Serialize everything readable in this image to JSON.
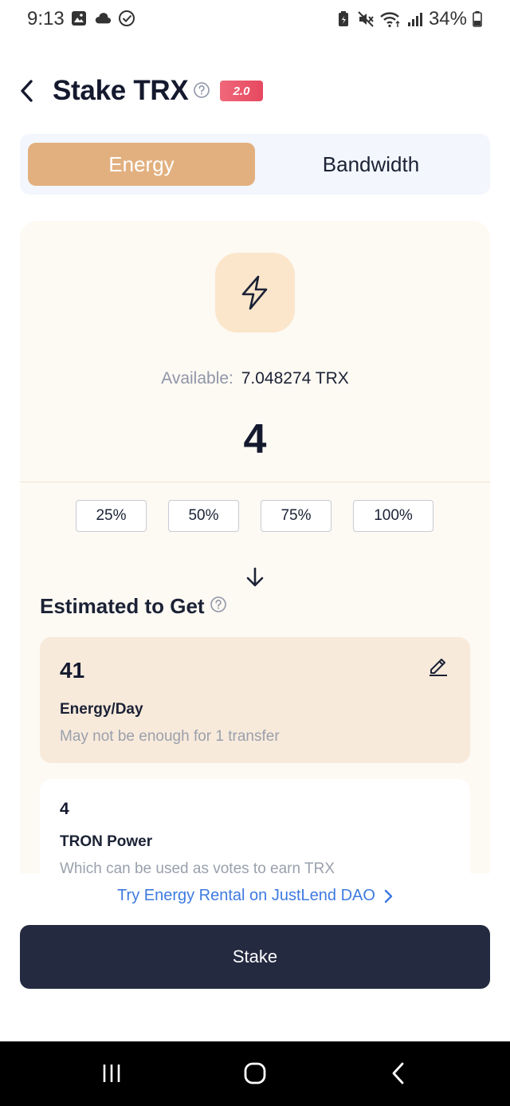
{
  "status_bar": {
    "time": "9:13",
    "battery": "34%",
    "left_icons": [
      "image-icon",
      "cloud-icon",
      "check-circle-icon"
    ],
    "right_icons": [
      "battery-saver-icon",
      "mute-icon",
      "wifi-icon",
      "signal-icon",
      "battery-icon"
    ]
  },
  "header": {
    "title": "Stake TRX",
    "badge": "2.0"
  },
  "tabs": [
    {
      "label": "Energy",
      "active": true
    },
    {
      "label": "Bandwidth",
      "active": false
    }
  ],
  "stake": {
    "available_label": "Available:",
    "available_value": "7.048274 TRX",
    "amount": "4",
    "percent_options": [
      "25%",
      "50%",
      "75%",
      "100%"
    ]
  },
  "estimate": {
    "title": "Estimated to Get",
    "energy": {
      "value": "41",
      "unit": "Energy/Day",
      "note": "May not be enough for 1 transfer"
    },
    "power": {
      "value": "4",
      "unit": "TRON Power",
      "note": "Which can be used as votes to earn TRX"
    }
  },
  "rental_link": "Try Energy Rental on JustLend DAO",
  "stake_button": "Stake",
  "colors": {
    "accent": "#e2b07f",
    "primary_button": "#242a40",
    "link": "#3d7ae0",
    "badge": "#e6485f"
  }
}
